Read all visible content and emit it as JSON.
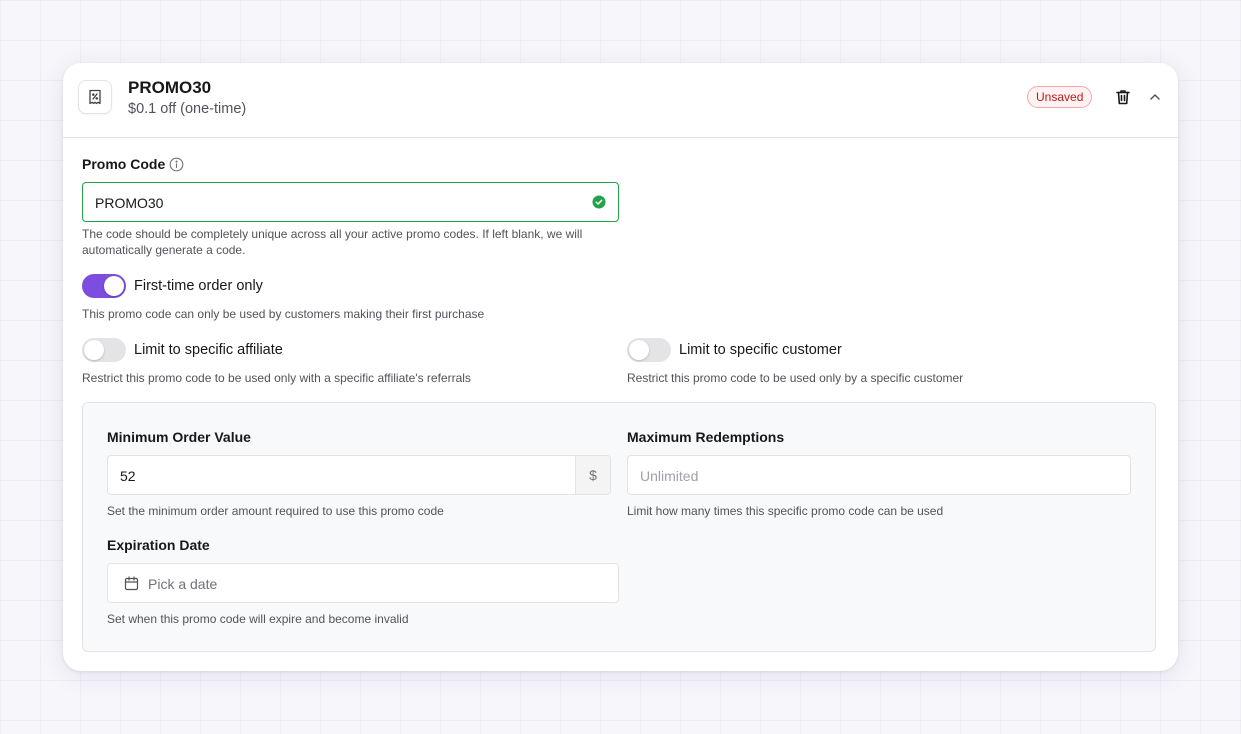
{
  "header": {
    "title": "PROMO30",
    "subtitle": "$0.1 off (one-time)",
    "status_badge": "Unsaved",
    "icons": [
      "receipt-icon",
      "trash-icon",
      "chevron-up-icon"
    ]
  },
  "promo_code": {
    "label": "Promo Code",
    "value": "PROMO30",
    "help": "The code should be completely unique across all your active promo codes. If left blank, we will automatically generate a code.",
    "valid": true
  },
  "toggles": {
    "first_time": {
      "label": "First-time order only",
      "help": "This promo code can only be used by customers making their first purchase",
      "on": true
    },
    "affiliate": {
      "label": "Limit to specific affiliate",
      "help": "Restrict this promo code to be used only with a specific affiliate's referrals",
      "on": false
    },
    "customer": {
      "label": "Limit to specific customer",
      "help": "Restrict this promo code to be used only by a specific customer",
      "on": false
    }
  },
  "limits": {
    "min_order": {
      "label": "Minimum Order Value",
      "value": "52",
      "suffix": "$",
      "help": "Set the minimum order amount required to use this promo code"
    },
    "max_redemptions": {
      "label": "Maximum Redemptions",
      "placeholder": "Unlimited",
      "help": "Limit how many times this specific promo code can be used"
    },
    "expiration": {
      "label": "Expiration Date",
      "placeholder": "Pick a date",
      "help": "Set when this promo code will expire and become invalid"
    }
  },
  "colors": {
    "accent": "#7c4ddf",
    "valid": "#22a34a",
    "badge_text": "#b91c1c",
    "badge_border": "#fca5a5"
  }
}
